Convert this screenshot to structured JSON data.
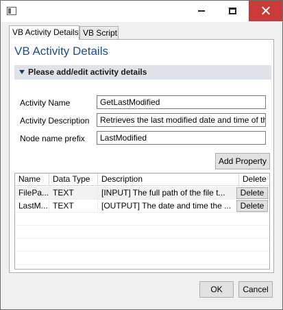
{
  "tabs": [
    {
      "label": "VB Activity Details"
    },
    {
      "label": "VB Script"
    }
  ],
  "page_title": "VB Activity Details",
  "section": {
    "title": "Please add/edit activity details"
  },
  "form": {
    "activity_name_label": "Activity Name",
    "activity_name_value": "GetLastModified",
    "activity_description_label": "Activity Description",
    "activity_description_value": "Retrieves the last modified date and time of th",
    "node_prefix_label": "Node name prefix",
    "node_prefix_value": "LastModified"
  },
  "add_property_label": "Add Property",
  "properties_table": {
    "columns": [
      "Name",
      "Data Type",
      "Description",
      "Delete"
    ],
    "rows": [
      {
        "name": "FilePa...",
        "type": "TEXT",
        "description": "[INPUT] The full path of the file t...",
        "delete_label": "Delete"
      },
      {
        "name": "LastM...",
        "type": "TEXT",
        "description": "[OUTPUT] The date and time the ...",
        "delete_label": "Delete"
      }
    ]
  },
  "footer": {
    "ok_label": "OK",
    "cancel_label": "Cancel"
  },
  "colors": {
    "title_blue": "#1d4f8a",
    "section_bg": "#dfe3e8",
    "close_red": "#c93b3b"
  },
  "icons": [
    "app-window-icon",
    "minimize-icon",
    "maximize-icon",
    "close-icon",
    "collapse-triangle-icon"
  ]
}
